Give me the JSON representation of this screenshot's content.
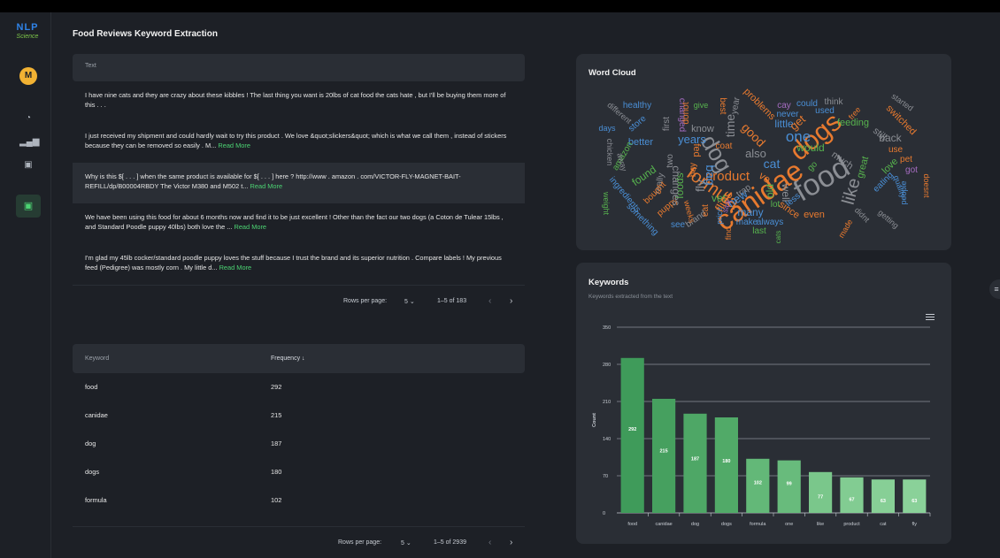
{
  "app": {
    "logo_line1": "NLP",
    "logo_line2": "Science",
    "avatar_initial": "M",
    "page_title": "Food Reviews Keyword Extraction"
  },
  "sidebar": {
    "icons": [
      "dashboard-icon",
      "chart-icon",
      "monitor-icon",
      "monitor-active-icon"
    ]
  },
  "reviews_table": {
    "header": "Text",
    "rows": [
      {
        "text": "I have nine cats and they are crazy about these kibbles ! The last thing you want is 20lbs of cat food the cats hate , but I'll be buying them more of this . . .",
        "link": ""
      },
      {
        "text": "I just received my shipment and could hardly wait to try this product . We love &quot;slickers&quot; which is what we call them , instead of stickers because they can be removed so easily . M...",
        "link": "Read More"
      },
      {
        "text": "Why is this $[ . . . ] when the same product is available for $[ . . . ] here ? http://www . amazon . com/VICTOR-FLY-MAGNET-BAIT-REFILL/dp/B00004RBDY The Victor M380 and M502 t...",
        "link": "Read More"
      },
      {
        "text": "We have been using this food for about 6 months now and find it to be just excellent ! Other than the fact our two dogs (a Coton de Tulear 15lbs , and Standard Poodle puppy 40lbs) both love the ...",
        "link": "Read More"
      },
      {
        "text": "I'm glad my 45lb cocker/standard poodle puppy loves the stuff because I trust the brand and its superior nutrition . Compare labels ! My previous feed (Pedigree) was mostly corn . My little d...",
        "link": "Read More"
      }
    ],
    "rows_per_page_label": "Rows per page:",
    "rows_per_page": "5",
    "range": "1–5 of 183"
  },
  "keywords_table": {
    "header_keyword": "Keyword",
    "header_frequency": "Frequency ↓",
    "rows": [
      {
        "keyword": "food",
        "frequency": "292"
      },
      {
        "keyword": "canidae",
        "frequency": "215"
      },
      {
        "keyword": "dog",
        "frequency": "187"
      },
      {
        "keyword": "dogs",
        "frequency": "180"
      },
      {
        "keyword": "formula",
        "frequency": "102"
      }
    ],
    "rows_per_page_label": "Rows per page:",
    "rows_per_page": "5",
    "range": "1–5 of 2939"
  },
  "word_cloud": {
    "title": "Word Cloud",
    "words": [
      {
        "w": "food",
        "c": "#8b8e94"
      },
      {
        "w": "canidae",
        "c": "#e87a2f"
      },
      {
        "w": "dogs",
        "c": "#e87a2f"
      },
      {
        "w": "dog",
        "c": "#8b8e94"
      },
      {
        "w": "formula",
        "c": "#e87a2f"
      },
      {
        "w": "product",
        "c": "#e87a2f"
      },
      {
        "w": "one",
        "c": "#4a8fd6"
      },
      {
        "w": "like",
        "c": "#8b8e94"
      },
      {
        "w": "cat",
        "c": "#4a8fd6"
      },
      {
        "w": "healthy",
        "c": "#4a8fd6"
      },
      {
        "w": "know",
        "c": "#8b8e94"
      },
      {
        "w": "years",
        "c": "#4a8fd6"
      },
      {
        "w": "better",
        "c": "#4a8fd6"
      },
      {
        "w": "also",
        "c": "#8b8e94"
      },
      {
        "w": "feeding",
        "c": "#57b34e"
      },
      {
        "w": "would",
        "c": "#57b34e"
      },
      {
        "w": "back",
        "c": "#8b8e94"
      },
      {
        "w": "new",
        "c": "#4a8fd6"
      },
      {
        "w": "many",
        "c": "#4a8fd6"
      },
      {
        "w": "even",
        "c": "#e87a2f"
      },
      {
        "w": "found",
        "c": "#57b34e"
      },
      {
        "w": "little",
        "c": "#4a8fd6"
      },
      {
        "w": "get",
        "c": "#e87a2f"
      },
      {
        "w": "used",
        "c": "#4a8fd6"
      },
      {
        "w": "pet",
        "c": "#e87a2f"
      },
      {
        "w": "vet",
        "c": "#57b34e"
      },
      {
        "w": "lot",
        "c": "#57b34e"
      },
      {
        "w": "last",
        "c": "#57b34e"
      },
      {
        "w": "make",
        "c": "#4a8fd6"
      },
      {
        "w": "always",
        "c": "#4a8fd6"
      },
      {
        "w": "give",
        "c": "#57b34e"
      },
      {
        "w": "best",
        "c": "#e87a2f"
      },
      {
        "w": "year",
        "c": "#8b8e94"
      },
      {
        "w": "problems",
        "c": "#e87a2f"
      },
      {
        "w": "cay",
        "c": "#a56cc1"
      },
      {
        "w": "could",
        "c": "#4a8fd6"
      },
      {
        "w": "think",
        "c": "#8b8e94"
      },
      {
        "w": "never",
        "c": "#4a8fd6"
      },
      {
        "w": "started",
        "c": "#8b8e94"
      },
      {
        "w": "switched",
        "c": "#e87a2f"
      },
      {
        "w": "days",
        "c": "#4a8fd6"
      },
      {
        "w": "store",
        "c": "#4a8fd6"
      },
      {
        "w": "different",
        "c": "#8b8e94"
      },
      {
        "w": "amazon",
        "c": "#57b34e"
      },
      {
        "w": "chicken",
        "c": "#8b8e94"
      },
      {
        "w": "ingredients",
        "c": "#4a8fd6"
      },
      {
        "w": "weight",
        "c": "#57b34e"
      },
      {
        "w": "something",
        "c": "#4a8fd6"
      },
      {
        "w": "puppy",
        "c": "#e87a2f"
      },
      {
        "w": "see",
        "c": "#4a8fd6"
      },
      {
        "w": "brand",
        "c": "#8b8e94"
      },
      {
        "w": "eat",
        "c": "#e87a2f"
      },
      {
        "w": "price",
        "c": "#4a8fd6"
      },
      {
        "w": "find",
        "c": "#e87a2f"
      },
      {
        "w": "cats",
        "c": "#57b34e"
      },
      {
        "w": "since",
        "c": "#e87a2f"
      },
      {
        "w": "well",
        "c": "#8b8e94"
      },
      {
        "w": "old",
        "c": "#57b34e"
      },
      {
        "w": "less",
        "c": "#4a8fd6"
      },
      {
        "w": "much",
        "c": "#8b8e94"
      },
      {
        "w": "great",
        "c": "#57b34e"
      },
      {
        "w": "still",
        "c": "#8b8e94"
      },
      {
        "w": "love",
        "c": "#57b34e"
      },
      {
        "w": "use",
        "c": "#e87a2f"
      },
      {
        "w": "got",
        "c": "#a56cc1"
      },
      {
        "w": "eating",
        "c": "#4a8fd6"
      },
      {
        "w": "quality",
        "c": "#4a8fd6"
      },
      {
        "w": "people",
        "c": "#4a8fd6"
      },
      {
        "w": "doesnt",
        "c": "#e87a2f"
      },
      {
        "w": "getting",
        "c": "#8b8e94"
      },
      {
        "w": "didnt",
        "c": "#8b8e94"
      },
      {
        "w": "made",
        "c": "#e87a2f"
      },
      {
        "w": "free",
        "c": "#e87a2f"
      },
      {
        "w": "go",
        "c": "#57b34e"
      },
      {
        "w": "coat",
        "c": "#e87a2f"
      },
      {
        "w": "good",
        "c": "#e87a2f"
      },
      {
        "w": "time",
        "c": "#8b8e94"
      },
      {
        "w": "bag",
        "c": "#4a8fd6"
      },
      {
        "w": "fed",
        "c": "#e87a2f"
      },
      {
        "w": "flies",
        "c": "#e87a2f"
      },
      {
        "w": "trap",
        "c": "#8b8e94"
      },
      {
        "w": "ve",
        "c": "#e87a2f"
      },
      {
        "w": "sick",
        "c": "#a56cc1"
      },
      {
        "w": "weeks",
        "c": "#e87a2f"
      },
      {
        "w": "changed",
        "c": "#a56cc1"
      },
      {
        "w": "first",
        "c": "#8b8e94"
      },
      {
        "w": "donot",
        "c": "#e87a2f"
      },
      {
        "w": "buy",
        "c": "#e87a2f"
      },
      {
        "w": "two",
        "c": "#8b8e94"
      },
      {
        "w": "away",
        "c": "#8b8e94"
      },
      {
        "w": "really",
        "c": "#8b8e94"
      },
      {
        "w": "bought",
        "c": "#e87a2f"
      },
      {
        "w": "foods",
        "c": "#57b34e"
      },
      {
        "w": "changes",
        "c": "#8b8e94"
      },
      {
        "w": "fly",
        "c": "#8b8e94"
      }
    ]
  },
  "keywords_chart": {
    "title": "Keywords",
    "subtitle": "Keywords extracted from the text",
    "menu_icon": "hamburger-menu-icon"
  },
  "chart_data": {
    "type": "bar",
    "categories": [
      "food",
      "canidae",
      "dog",
      "dogs",
      "formula",
      "one",
      "like",
      "product",
      "cat",
      "fly"
    ],
    "values": [
      292,
      215,
      187,
      180,
      102,
      99,
      77,
      67,
      63,
      63
    ],
    "title": "Keywords",
    "subtitle": "Keywords extracted from the text",
    "xlabel": "",
    "ylabel": "Count",
    "ylim": [
      0,
      350
    ],
    "yticks": [
      0,
      70,
      140,
      210,
      280,
      350
    ],
    "grid": true,
    "data_labels": true,
    "colors": [
      "#3f9b5a",
      "#46a05f",
      "#4ea766",
      "#51aa68",
      "#63b878",
      "#68bb7c",
      "#7ac78b",
      "#82cc92",
      "#87cf96",
      "#8ad199"
    ]
  }
}
